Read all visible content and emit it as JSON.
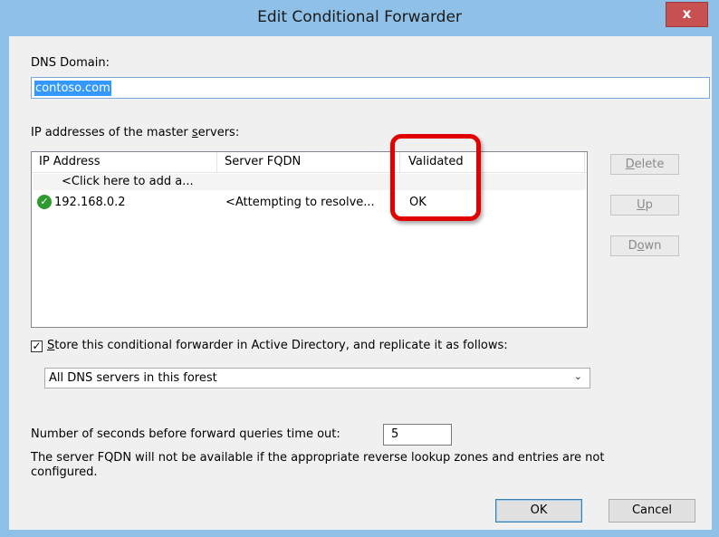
{
  "window": {
    "title": "Edit Conditional Forwarder",
    "close_glyph": "x"
  },
  "dns_domain": {
    "label": "DNS Domain:",
    "value": "contoso.com"
  },
  "master_servers": {
    "label_prefix": "IP addresses of the master ",
    "label_underlined": "s",
    "label_suffix": "ervers:",
    "columns": [
      "IP Address",
      "Server FQDN",
      "Validated"
    ],
    "add_row": "<Click here to add a...",
    "rows": [
      {
        "ip": "192.168.0.2",
        "fqdn": "<Attempting to resolve...",
        "validated": "OK",
        "status_icon": "check-circle-icon"
      }
    ]
  },
  "side_buttons": {
    "delete": {
      "u": "D",
      "rest": "elete"
    },
    "up": {
      "u": "U",
      "rest": "p"
    },
    "down": {
      "pre": "D",
      "u": "o",
      "rest": "wn"
    }
  },
  "store_ad": {
    "checked": true,
    "check_glyph": "✓",
    "label_u": "S",
    "label_rest": "tore this conditional forwarder in Active Directory, and replicate it as follows:"
  },
  "replication": {
    "selected": "All DNS servers in this forest",
    "arrow_glyph": "⌄"
  },
  "timeout": {
    "label": "Number of seconds before forward queries time out:",
    "value": "5"
  },
  "note": {
    "line1": "The server FQDN will not be available if the appropriate reverse lookup zones and entries are not",
    "line2": "configured."
  },
  "buttons": {
    "ok": "OK",
    "cancel": "Cancel"
  },
  "colors": {
    "highlight": "#e00000",
    "titlebar": "#8fc0e8",
    "selection": "#3399ff"
  }
}
